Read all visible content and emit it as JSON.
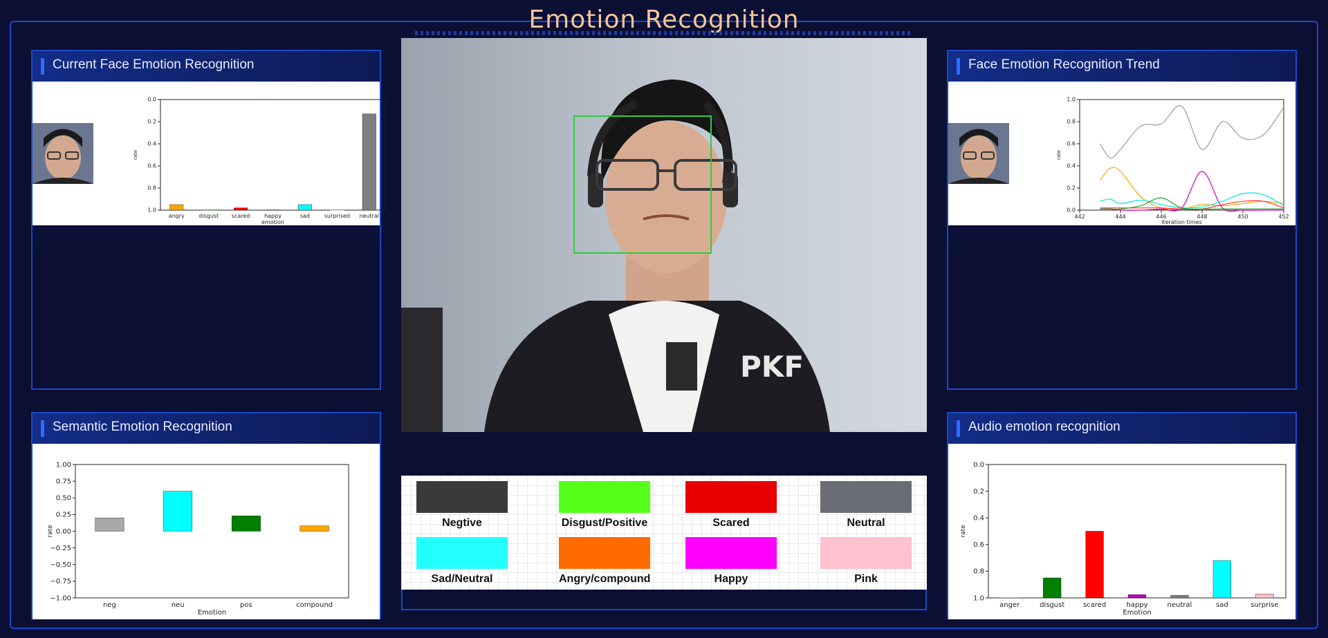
{
  "app": {
    "title": "Emotion Recognition"
  },
  "panels": {
    "current_face": {
      "title": "Current Face Emotion Recognition"
    },
    "trend": {
      "title": "Face Emotion Recognition Trend"
    },
    "semantic": {
      "title": "Semantic Emotion Recognition"
    },
    "audio": {
      "title": "Audio emotion recognition"
    }
  },
  "legend": {
    "items": [
      {
        "label": "Negtive",
        "color": "#3a3a3a"
      },
      {
        "label": "Disgust/Positive",
        "color": "#55ff1a"
      },
      {
        "label": "Scared",
        "color": "#e60000"
      },
      {
        "label": "Neutral",
        "color": "#6b6d75"
      },
      {
        "label": "Sad/Neutral",
        "color": "#22ffff"
      },
      {
        "label": "Angry/compound",
        "color": "#ff6a00"
      },
      {
        "label": "Happy",
        "color": "#ff00ff"
      },
      {
        "label": "Pink",
        "color": "#ffc0d0"
      }
    ]
  },
  "chart_data": [
    {
      "id": "current_face",
      "type": "bar",
      "categories": [
        "angry",
        "disgust",
        "scared",
        "happy",
        "sad",
        "surprised",
        "neutral"
      ],
      "values": [
        0.05,
        0.0,
        0.02,
        0.005,
        0.05,
        0.0,
        0.87
      ],
      "colors": [
        "#ffa500",
        "#008000",
        "#ff0000",
        "#c000c0",
        "#00ffff",
        "#ffc0cb",
        "#808080"
      ],
      "xlabel": "emotion",
      "ylabel": "rate",
      "ylim": [
        0,
        1.0
      ],
      "yticks": [
        "0.0",
        "0.2",
        "0.4",
        "0.6",
        "0.8",
        "1.0"
      ]
    },
    {
      "id": "trend",
      "type": "line",
      "x": [
        443,
        443.5,
        444,
        445,
        446,
        447,
        448,
        449,
        450,
        451,
        452
      ],
      "xticks": [
        "442",
        "444",
        "446",
        "448",
        "450",
        "452"
      ],
      "xlim": [
        442,
        452
      ],
      "ylim": [
        0,
        1.0
      ],
      "yticks": [
        "0.0",
        "0.2",
        "0.4",
        "0.6",
        "0.8",
        "1.0"
      ],
      "xlabel": "iteration times",
      "ylabel": "rate",
      "series": [
        {
          "color": "#9a9a9a",
          "values": [
            0.6,
            0.47,
            0.55,
            0.76,
            0.78,
            0.94,
            0.55,
            0.8,
            0.65,
            0.68,
            0.93
          ]
        },
        {
          "color": "#ffa500",
          "values": [
            0.27,
            0.38,
            0.35,
            0.12,
            0.02,
            0.01,
            0.05,
            0.04,
            0.06,
            0.08,
            0.06
          ]
        },
        {
          "color": "#cc00cc",
          "values": [
            0.01,
            0.01,
            0.0,
            0.0,
            0.01,
            0.02,
            0.35,
            0.02,
            0.0,
            0.0,
            0.0
          ]
        },
        {
          "color": "#00e5ee",
          "values": [
            0.08,
            0.1,
            0.06,
            0.09,
            0.05,
            0.02,
            0.03,
            0.08,
            0.15,
            0.14,
            0.04
          ]
        },
        {
          "color": "#ff3030",
          "values": [
            0.02,
            0.02,
            0.02,
            0.02,
            0.02,
            0.01,
            0.01,
            0.05,
            0.08,
            0.08,
            0.02
          ]
        },
        {
          "color": "#1fa01f",
          "values": [
            0.01,
            0.01,
            0.01,
            0.04,
            0.11,
            0.02,
            0.01,
            0.01,
            0.01,
            0.01,
            0.01
          ]
        }
      ]
    },
    {
      "id": "semantic",
      "type": "bar",
      "categories": [
        "neg",
        "neu",
        "pos",
        "compound"
      ],
      "values": [
        0.2,
        0.6,
        0.23,
        0.08
      ],
      "colors": [
        "#a9a9a9",
        "#00ffff",
        "#008000",
        "#ffa500"
      ],
      "xlabel": "Emotion",
      "ylabel": "rate",
      "ylim": [
        -1.0,
        1.0
      ],
      "yticks": [
        "1.00",
        "0.75",
        "0.50",
        "0.25",
        "0.00",
        "−0.25",
        "−0.50",
        "−0.75",
        "−1.00"
      ]
    },
    {
      "id": "audio",
      "type": "bar",
      "categories": [
        "anger",
        "disgust",
        "scared",
        "happy",
        "neutral",
        "sad",
        "surprise"
      ],
      "values": [
        0.005,
        0.15,
        0.5,
        0.025,
        0.02,
        0.28,
        0.03
      ],
      "colors": [
        "#ffa500",
        "#008000",
        "#ff0000",
        "#c000c0",
        "#808080",
        "#00ffff",
        "#ffc0cb"
      ],
      "xlabel": "Emotion",
      "ylabel": "rate",
      "ylim": [
        0,
        1.0
      ],
      "yticks": [
        "0.0",
        "0.2",
        "0.4",
        "0.6",
        "0.8",
        "1.0"
      ]
    }
  ]
}
